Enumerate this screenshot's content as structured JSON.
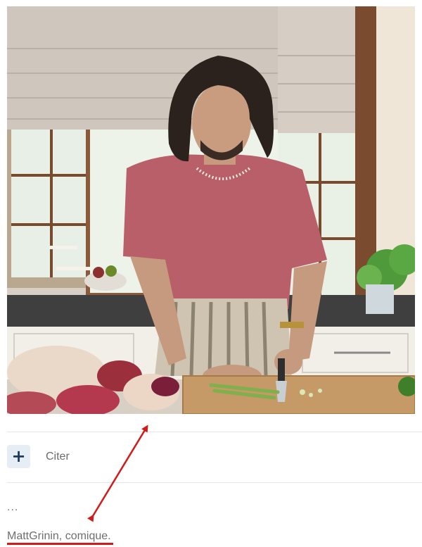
{
  "post": {
    "quote_button": {
      "icon": "plus-icon",
      "label": "Citer"
    },
    "ellipsis": "...",
    "caption": {
      "name": "MattGrinin, comique",
      "suffix": "."
    }
  },
  "annotation": {
    "color": "#d31a1a"
  }
}
